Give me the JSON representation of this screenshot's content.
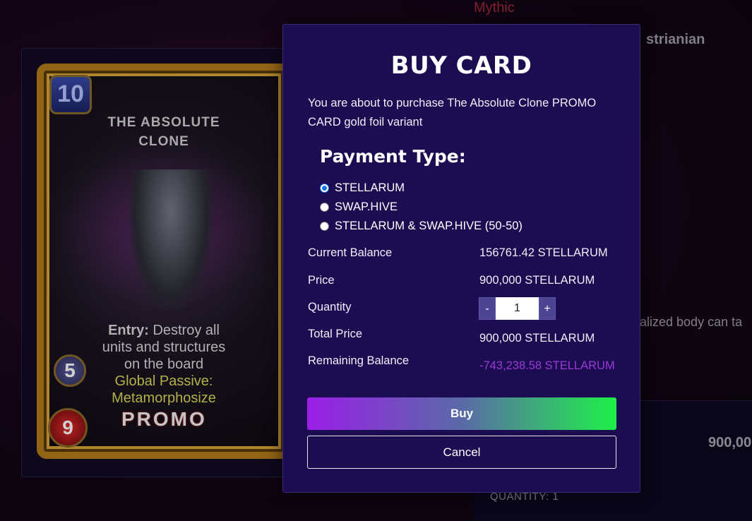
{
  "background": {
    "rarity": "Mythic",
    "card_name_partial": "strianian",
    "description_partial": "alized body can ta",
    "price_partial": "900,00",
    "quantity_label": "QUANTITY: 1"
  },
  "card": {
    "mana": "10",
    "title_line1": "THE ABSOLUTE",
    "title_line2": "CLONE",
    "ability_label": "Entry:",
    "ability_text_1": "Destroy all",
    "ability_text_2": "units and structures",
    "ability_text_3": "on the board",
    "passive_line1": "Global Passive:",
    "passive_line2": "Metamorphosize",
    "promo": "PROMO",
    "attack": "5",
    "health": "9"
  },
  "modal": {
    "title": "BUY CARD",
    "intro": "You are about to purchase The Absolute Clone PROMO CARD gold foil variant",
    "payment_heading": "Payment Type:",
    "payment_options": [
      {
        "label": "STELLARUM",
        "checked": true
      },
      {
        "label": "SWAP.HIVE",
        "checked": false
      },
      {
        "label": "STELLARUM & SWAP.HIVE (50-50)",
        "checked": false
      }
    ],
    "current_balance_label": "Current Balance",
    "current_balance_value": "156761.42 STELLARUM",
    "price_label": "Price",
    "price_value": "900,000 STELLARUM",
    "quantity_label": "Quantity",
    "quantity_minus": "-",
    "quantity_value": "1",
    "quantity_plus": "+",
    "total_price_label": "Total Price",
    "total_price_value": "900,000 STELLARUM",
    "remaining_label": "Remaining Balance",
    "remaining_value": "-743,238.58 STELLARUM",
    "buy_label": "Buy",
    "cancel_label": "Cancel"
  },
  "colors": {
    "modal_bg": "#1c0c52",
    "negative_balance": "#9b3ad6",
    "buy_gradient_start": "#9b1ee8",
    "buy_gradient_end": "#1ef048"
  }
}
